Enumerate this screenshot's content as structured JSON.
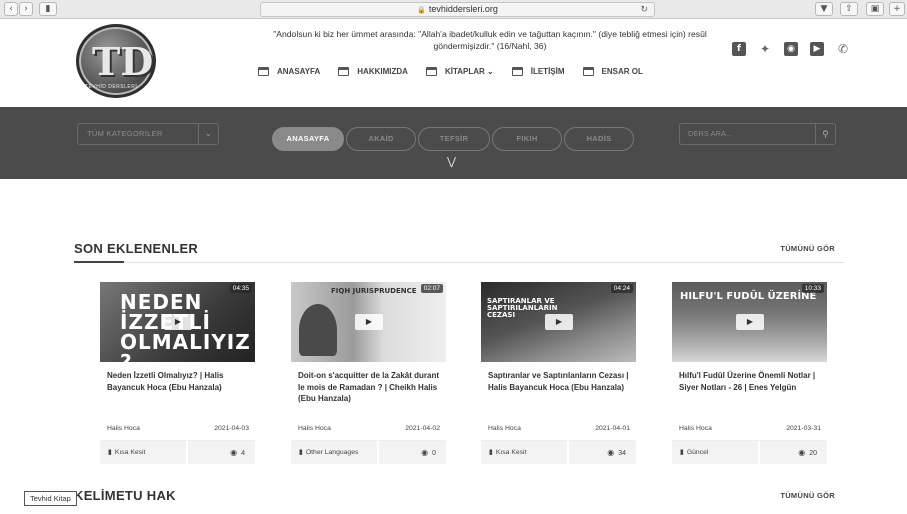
{
  "browser": {
    "url": "tevhiddersleri.org",
    "back_icon": "chevron-left",
    "forward_icon": "chevron-right"
  },
  "header": {
    "logo_letters": "TD",
    "logo_ring_text": "TEVHİD DERSLERİ",
    "quote": "\"Andolsun ki biz her ümmet arasında: \"Allah'a ibadet/kulluk edin ve tağuttan kaçının.\" (diye tebliğ etmesi için) resûl göndermişizdir.\" (16/Nahl, 36)",
    "nav": [
      {
        "label": "ANASAYFA"
      },
      {
        "label": "HAKKIMIZDA"
      },
      {
        "label": "KİTAPLAR ⌄"
      },
      {
        "label": "İLETİŞİM"
      },
      {
        "label": "ENSAR OL"
      }
    ],
    "social": [
      "facebook-icon",
      "twitter-icon",
      "instagram-icon",
      "youtube-icon",
      "whatsapp-icon"
    ]
  },
  "filterbar": {
    "category_select": "TÜM KATEGORİLER",
    "tabs": [
      {
        "label": "ANASAYFA",
        "active": true
      },
      {
        "label": "AKAİD"
      },
      {
        "label": "TEFSİR"
      },
      {
        "label": "FIKIH"
      },
      {
        "label": "HADİS"
      }
    ],
    "search_placeholder": "DERS ARA..."
  },
  "latest": {
    "title": "SON EKLENENLER",
    "see_all": "TÜMÜNÜ GÖR",
    "cards": [
      {
        "duration": "04:35",
        "thumb_text": "NEDEN İZZETLİ OLMALIYIZ ?",
        "title": "Neden İzzetli Olmalıyız? | Halis Bayancuk Hoca (Ebu Hanzala)",
        "author": "Halis Hoca",
        "date": "2021-04-03",
        "category": "Kısa Kesit",
        "views": "4"
      },
      {
        "duration": "02:07",
        "thumb_text": "FIQH JURISPRUDENCE",
        "title": "Doit-on s'acquitter de la Zakât durant le mois de Ramadan ? | Cheikh Halis (Ebu Hanzala)",
        "author": "Halis Hoca",
        "date": "2021-04-02",
        "category": "Other Languages",
        "views": "0"
      },
      {
        "duration": "04:24",
        "thumb_text": "SAPTIRANLAR VE SAPTIRILANLARIN CEZASI",
        "title": "Saptıranlar ve Saptırılanların Cezası | Halis Bayancuk Hoca (Ebu Hanzala)",
        "author": "Halis Hoca",
        "date": "2021-04-01",
        "category": "Kısa Kesit",
        "views": "34"
      },
      {
        "duration": "10:33",
        "thumb_text": "HILFU'L FUDÛL ÜZERİNE",
        "title": "Hılfu'l Fudûl Üzerine Önemli Notlar | Siyer Notları - 26 | Enes Yelgün",
        "author": "Halis Hoca",
        "date": "2021-03-31",
        "category": "Güncel",
        "views": "20"
      }
    ]
  },
  "kelimetu": {
    "title": "KELİMETU HAK",
    "see_all": "TÜMÜNÜ GÖR"
  },
  "tooltip": "Tevhid Kitap"
}
